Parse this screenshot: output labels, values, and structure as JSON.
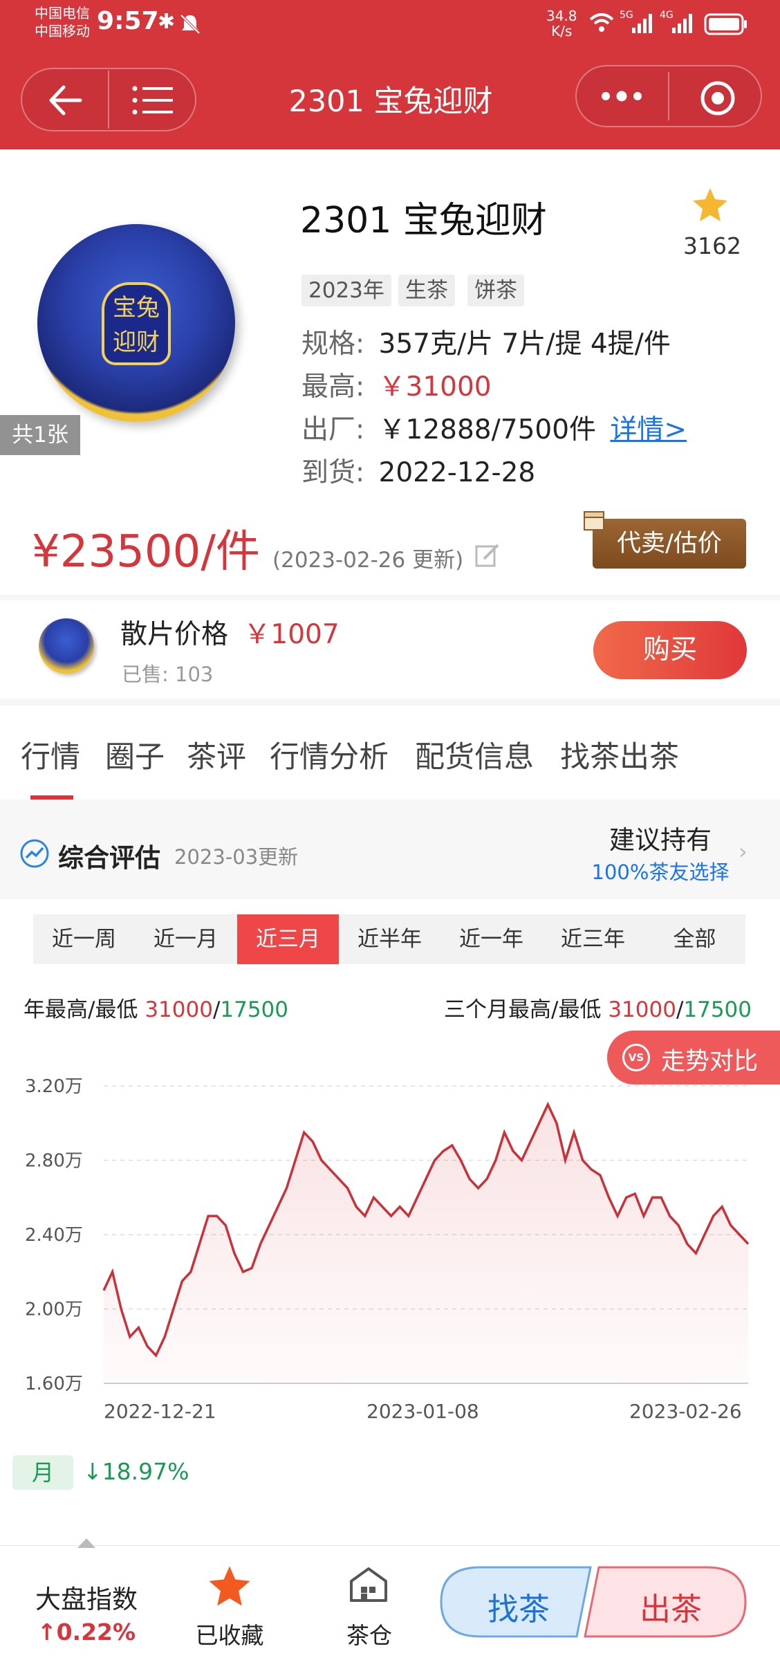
{
  "status": {
    "carrier1": "中国电信",
    "carrier2": "中国移动",
    "time": "9:57",
    "speed_value": "34.8",
    "speed_unit": "K/s",
    "net1": "5G",
    "net2": "4G"
  },
  "nav": {
    "title": "2301 宝兔迎财"
  },
  "product": {
    "name": "2301 宝兔迎财",
    "fav_count": "3162",
    "tags": [
      "2023年",
      "生茶",
      "饼茶"
    ],
    "spec_label": "规格:",
    "spec_value": "357克/片 7片/提 4提/件",
    "high_label": "最高:",
    "high_value": "￥31000",
    "factory_label": "出厂:",
    "factory_value": "￥12888/7500件",
    "factory_link": "详情>",
    "arrival_label": "到货:",
    "arrival_value": "2022-12-28",
    "image_count": "共1张",
    "cake_text1": "宝兔",
    "cake_text2": "迎财",
    "price": "¥23500/件",
    "price_update": "(2023-02-26 更新)",
    "consign_button": "代卖/估价"
  },
  "loose": {
    "label": "散片价格",
    "price": "￥1007",
    "sold": "已售: 103",
    "buy_button": "购买"
  },
  "tabs": [
    "行情",
    "圈子",
    "茶评",
    "行情分析",
    "配货信息",
    "找茶出茶"
  ],
  "assessment": {
    "title": "综合评估",
    "date": "2023-03更新",
    "advice": "建议持有",
    "advice_sub": "100%茶友选择"
  },
  "periods": [
    "近一周",
    "近一月",
    "近三月",
    "近半年",
    "近一年",
    "近三年",
    "全部"
  ],
  "selected_period": "近三月",
  "stats": {
    "year_label": "年最高/最低",
    "year_high": "31000",
    "year_low": "17500",
    "q_label": "三个月最高/最低",
    "q_high": "31000",
    "q_low": "17500",
    "slash": "/"
  },
  "compare_button": "走势对比",
  "compare_badge": "VS",
  "monthly": {
    "label": "月",
    "change": "↓18.97%"
  },
  "bottom": {
    "index_label": "大盘指数",
    "index_change": "↑0.22%",
    "fav": "已收藏",
    "warehouse": "茶仓",
    "find": "找茶",
    "sell": "出茶"
  },
  "colors": {
    "primary": "#d5363c",
    "rise": "#d5363c",
    "fall": "#1a9a55",
    "consign": "#8f5a2a",
    "link": "#1a73e8"
  },
  "chart_data": {
    "type": "line",
    "yunit": "万",
    "ylim": [
      1.6,
      3.2
    ],
    "yticks": [
      "3.20万",
      "2.80万",
      "2.40万",
      "2.00万",
      "1.60万"
    ],
    "xticks": [
      "2022-12-21",
      "2023-01-08",
      "2023-02-26"
    ],
    "grid": true,
    "values": [
      2.1,
      2.2,
      2.0,
      1.85,
      1.9,
      1.8,
      1.75,
      1.85,
      2.0,
      2.15,
      2.2,
      2.35,
      2.5,
      2.5,
      2.45,
      2.3,
      2.2,
      2.22,
      2.35,
      2.45,
      2.55,
      2.65,
      2.8,
      2.95,
      2.9,
      2.8,
      2.75,
      2.7,
      2.65,
      2.55,
      2.5,
      2.6,
      2.55,
      2.5,
      2.55,
      2.5,
      2.6,
      2.7,
      2.8,
      2.85,
      2.88,
      2.8,
      2.7,
      2.65,
      2.7,
      2.8,
      2.95,
      2.85,
      2.8,
      2.9,
      3.0,
      3.1,
      3.0,
      2.8,
      2.95,
      2.8,
      2.75,
      2.72,
      2.6,
      2.5,
      2.6,
      2.62,
      2.5,
      2.6,
      2.6,
      2.5,
      2.45,
      2.35,
      2.3,
      2.4,
      2.5,
      2.55,
      2.45,
      2.4,
      2.35
    ]
  }
}
